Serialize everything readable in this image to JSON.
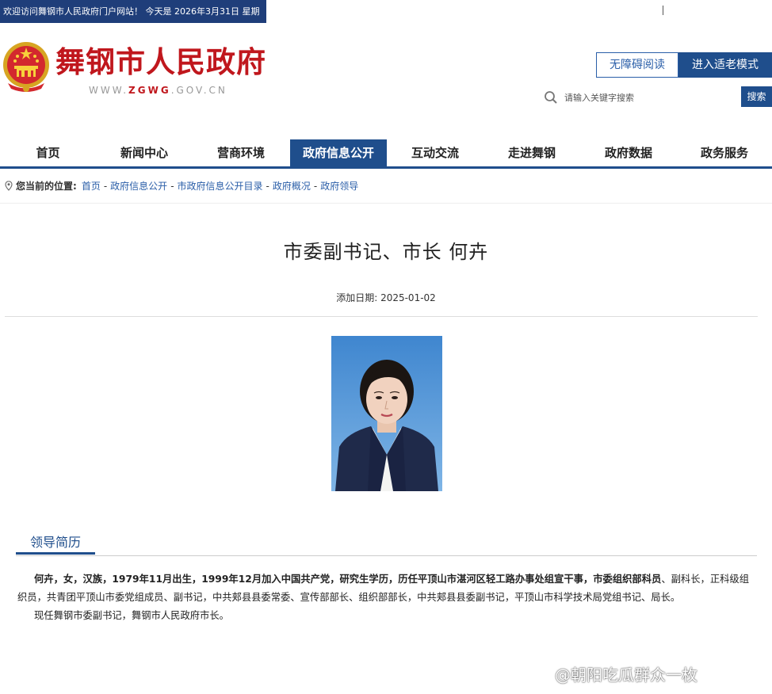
{
  "topbar": {
    "welcome_text": "欢迎访问舞钢市人民政府门户网站！  今天是 2026年3月31日 星期"
  },
  "header": {
    "site_title": "舞钢市人民政府",
    "site_url_prefix": "WWW.",
    "site_url_highlight": "ZGWG",
    "site_url_suffix": ".GOV.CN",
    "accessible_button": "无障碍阅读",
    "elderly_mode_button": "进入适老模式",
    "search_placeholder": "请输入关键字搜索",
    "search_button": "搜索"
  },
  "nav": {
    "items": [
      {
        "label": "首页"
      },
      {
        "label": "新闻中心"
      },
      {
        "label": "营商环境"
      },
      {
        "label": "政府信息公开"
      },
      {
        "label": "互动交流"
      },
      {
        "label": "走进舞钢"
      },
      {
        "label": "政府数据"
      },
      {
        "label": "政务服务"
      }
    ],
    "active": "政府信息公开"
  },
  "breadcrumb": {
    "label": "您当前的位置:",
    "items": [
      "首页",
      "政府信息公开",
      "市政府信息公开目录",
      "政府概况",
      "政府领导"
    ],
    "separator": "-"
  },
  "article": {
    "title": "市委副书记、市长 何卉",
    "date_label": "添加日期:",
    "date": "2025-01-02"
  },
  "resume": {
    "tab_label": "领导简历",
    "bio_bold_1": "何卉，女，汉族，1979年11月出生，1999年12月加入中国共产党，研究生学历，历任平顶山市湛河区轻工路办事处组宣干事，",
    "bio_bold_2": "市委组织部科员",
    "bio_rest": "、副科长，正科级组织员，共青团平顶山市委党组成员、副书记，中共郏县县委常委、宣传部部长、组织部部长，中共郏县县委副书记，平顶山市科学技术局党组书记、局长。",
    "bio_current": "现任舞钢市委副书记，舞钢市人民政府市长。"
  },
  "watermark": "@朝阳吃瓜群众一枚",
  "colors": {
    "brand_blue": "#1f4e8c",
    "title_red": "#c0171d",
    "welcome_bg": "#1f3e7a"
  }
}
